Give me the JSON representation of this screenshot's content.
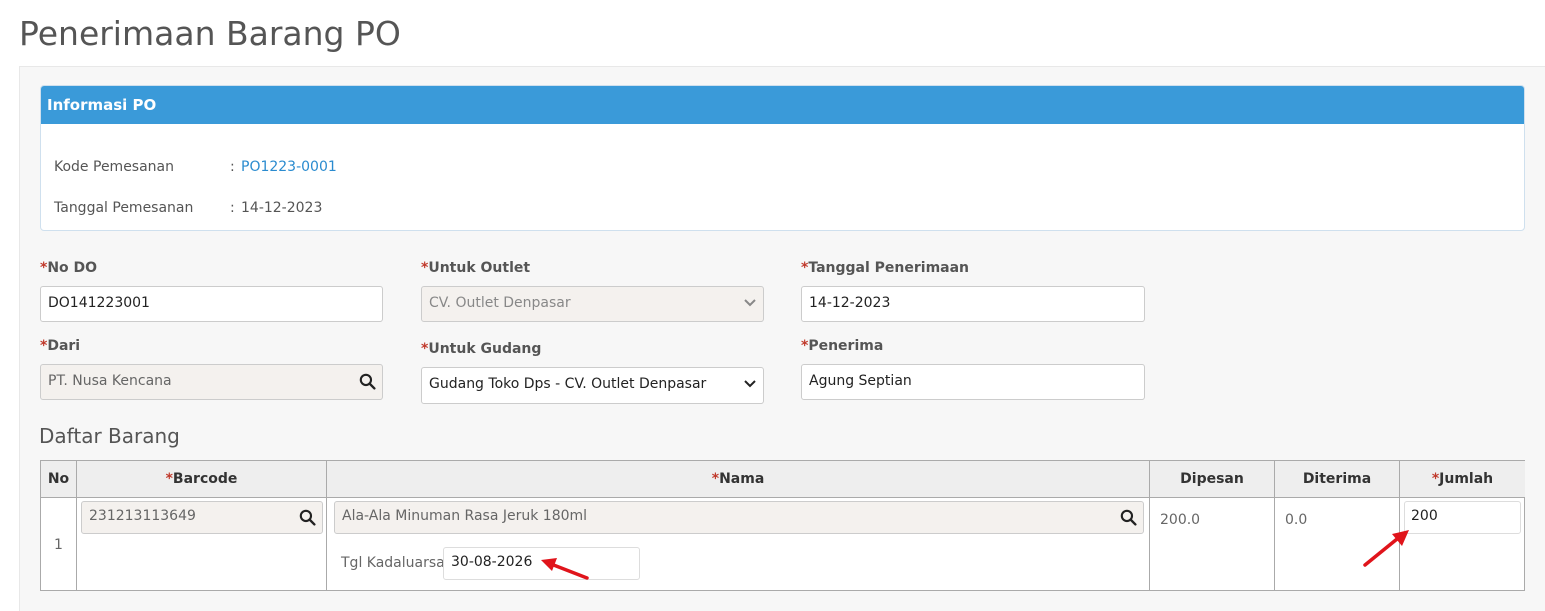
{
  "page": {
    "title": "Penerimaan Barang PO"
  },
  "info_po": {
    "heading": "Informasi PO",
    "kode_label": "Kode Pemesanan",
    "kode_value": "PO1223-0001",
    "tanggal_label": "Tanggal Pemesanan",
    "tanggal_value": "14-12-2023",
    "colon": ":"
  },
  "form": {
    "required_mark": "*",
    "no_do": {
      "label": "No DO",
      "value": "DO141223001"
    },
    "dari": {
      "label": "Dari",
      "value": "PT. Nusa Kencana"
    },
    "untuk_outlet": {
      "label": "Untuk Outlet",
      "value": "CV. Outlet Denpasar"
    },
    "untuk_gudang": {
      "label": "Untuk Gudang",
      "value": "Gudang Toko Dps - CV. Outlet Denpasar"
    },
    "tanggal_penerimaan": {
      "label": "Tanggal Penerimaan",
      "value": "14-12-2023"
    },
    "penerima": {
      "label": "Penerima",
      "value": "Agung Septian"
    }
  },
  "daftar_barang": {
    "title": "Daftar Barang",
    "columns": [
      "No",
      "Barcode",
      "Nama",
      "Dipesan",
      "Diterima",
      "Jumlah"
    ],
    "rows": [
      {
        "no": "1",
        "barcode": "231213113649",
        "nama": "Ala-Ala Minuman Rasa Jeruk 180ml",
        "tgl_kadaluarsa_label": "Tgl Kadaluarsa",
        "tgl_kadaluarsa": "30-08-2026",
        "dipesan": "200.0",
        "diterima": "0.0",
        "jumlah": "200"
      }
    ]
  },
  "icons": {
    "search": "search-icon",
    "chevron": "chevron-down-icon",
    "annotation": "red-arrow-icon"
  },
  "colors": {
    "panel_heading": "#3a9ad9",
    "link": "#2a8bcf",
    "required": "#c0392b",
    "annotation_arrow": "#e0141b"
  }
}
